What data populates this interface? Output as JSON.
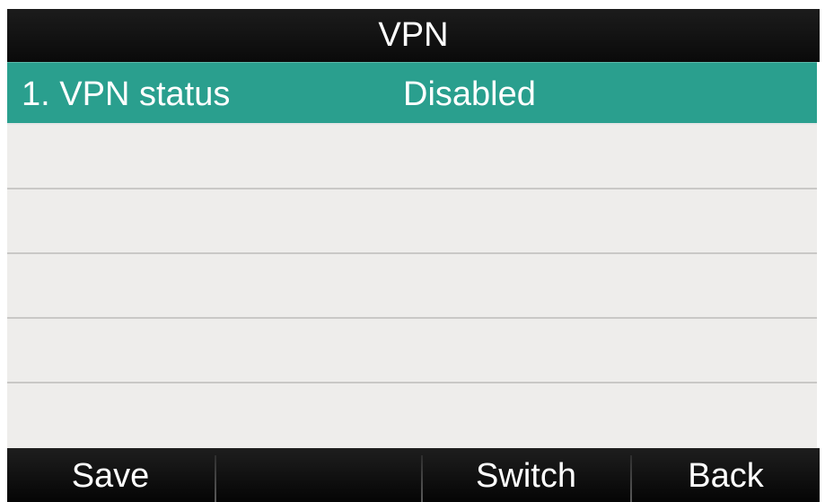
{
  "header": {
    "title": "VPN"
  },
  "list": {
    "items": [
      {
        "label": "1. VPN status",
        "value": "Disabled",
        "selected": true
      },
      {
        "label": "",
        "value": ""
      },
      {
        "label": "",
        "value": ""
      },
      {
        "label": "",
        "value": ""
      },
      {
        "label": "",
        "value": ""
      },
      {
        "label": "",
        "value": ""
      }
    ]
  },
  "softkeys": {
    "key1": "Save",
    "key2": "",
    "key3": "Switch",
    "key4": "Back"
  },
  "colors": {
    "selection": "#2a9f8e",
    "bars": "#111111",
    "list_background": "#eeedeb"
  }
}
